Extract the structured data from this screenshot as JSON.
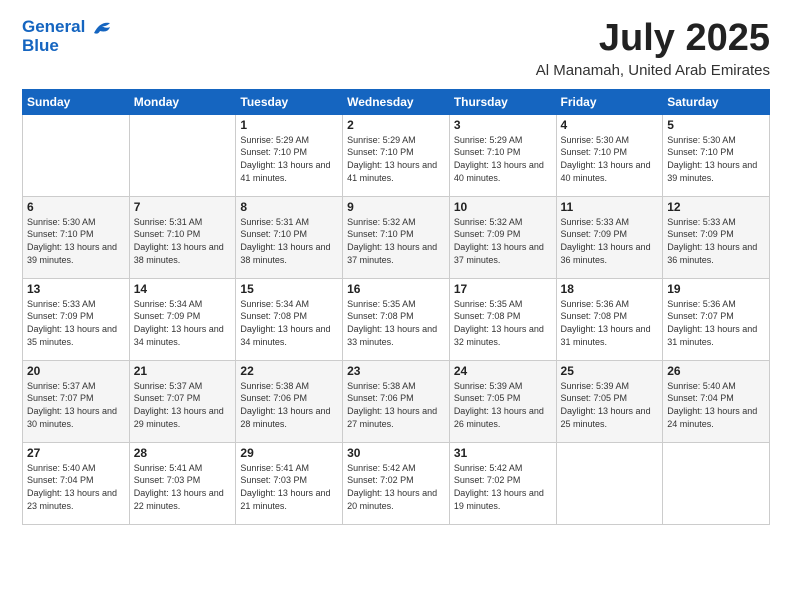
{
  "header": {
    "logo_line1": "General",
    "logo_line2": "Blue",
    "month": "July 2025",
    "location": "Al Manamah, United Arab Emirates"
  },
  "weekdays": [
    "Sunday",
    "Monday",
    "Tuesday",
    "Wednesday",
    "Thursday",
    "Friday",
    "Saturday"
  ],
  "weeks": [
    [
      {
        "day": "",
        "sunrise": "",
        "sunset": "",
        "daylight": ""
      },
      {
        "day": "",
        "sunrise": "",
        "sunset": "",
        "daylight": ""
      },
      {
        "day": "1",
        "sunrise": "Sunrise: 5:29 AM",
        "sunset": "Sunset: 7:10 PM",
        "daylight": "Daylight: 13 hours and 41 minutes."
      },
      {
        "day": "2",
        "sunrise": "Sunrise: 5:29 AM",
        "sunset": "Sunset: 7:10 PM",
        "daylight": "Daylight: 13 hours and 41 minutes."
      },
      {
        "day": "3",
        "sunrise": "Sunrise: 5:29 AM",
        "sunset": "Sunset: 7:10 PM",
        "daylight": "Daylight: 13 hours and 40 minutes."
      },
      {
        "day": "4",
        "sunrise": "Sunrise: 5:30 AM",
        "sunset": "Sunset: 7:10 PM",
        "daylight": "Daylight: 13 hours and 40 minutes."
      },
      {
        "day": "5",
        "sunrise": "Sunrise: 5:30 AM",
        "sunset": "Sunset: 7:10 PM",
        "daylight": "Daylight: 13 hours and 39 minutes."
      }
    ],
    [
      {
        "day": "6",
        "sunrise": "Sunrise: 5:30 AM",
        "sunset": "Sunset: 7:10 PM",
        "daylight": "Daylight: 13 hours and 39 minutes."
      },
      {
        "day": "7",
        "sunrise": "Sunrise: 5:31 AM",
        "sunset": "Sunset: 7:10 PM",
        "daylight": "Daylight: 13 hours and 38 minutes."
      },
      {
        "day": "8",
        "sunrise": "Sunrise: 5:31 AM",
        "sunset": "Sunset: 7:10 PM",
        "daylight": "Daylight: 13 hours and 38 minutes."
      },
      {
        "day": "9",
        "sunrise": "Sunrise: 5:32 AM",
        "sunset": "Sunset: 7:10 PM",
        "daylight": "Daylight: 13 hours and 37 minutes."
      },
      {
        "day": "10",
        "sunrise": "Sunrise: 5:32 AM",
        "sunset": "Sunset: 7:09 PM",
        "daylight": "Daylight: 13 hours and 37 minutes."
      },
      {
        "day": "11",
        "sunrise": "Sunrise: 5:33 AM",
        "sunset": "Sunset: 7:09 PM",
        "daylight": "Daylight: 13 hours and 36 minutes."
      },
      {
        "day": "12",
        "sunrise": "Sunrise: 5:33 AM",
        "sunset": "Sunset: 7:09 PM",
        "daylight": "Daylight: 13 hours and 36 minutes."
      }
    ],
    [
      {
        "day": "13",
        "sunrise": "Sunrise: 5:33 AM",
        "sunset": "Sunset: 7:09 PM",
        "daylight": "Daylight: 13 hours and 35 minutes."
      },
      {
        "day": "14",
        "sunrise": "Sunrise: 5:34 AM",
        "sunset": "Sunset: 7:09 PM",
        "daylight": "Daylight: 13 hours and 34 minutes."
      },
      {
        "day": "15",
        "sunrise": "Sunrise: 5:34 AM",
        "sunset": "Sunset: 7:08 PM",
        "daylight": "Daylight: 13 hours and 34 minutes."
      },
      {
        "day": "16",
        "sunrise": "Sunrise: 5:35 AM",
        "sunset": "Sunset: 7:08 PM",
        "daylight": "Daylight: 13 hours and 33 minutes."
      },
      {
        "day": "17",
        "sunrise": "Sunrise: 5:35 AM",
        "sunset": "Sunset: 7:08 PM",
        "daylight": "Daylight: 13 hours and 32 minutes."
      },
      {
        "day": "18",
        "sunrise": "Sunrise: 5:36 AM",
        "sunset": "Sunset: 7:08 PM",
        "daylight": "Daylight: 13 hours and 31 minutes."
      },
      {
        "day": "19",
        "sunrise": "Sunrise: 5:36 AM",
        "sunset": "Sunset: 7:07 PM",
        "daylight": "Daylight: 13 hours and 31 minutes."
      }
    ],
    [
      {
        "day": "20",
        "sunrise": "Sunrise: 5:37 AM",
        "sunset": "Sunset: 7:07 PM",
        "daylight": "Daylight: 13 hours and 30 minutes."
      },
      {
        "day": "21",
        "sunrise": "Sunrise: 5:37 AM",
        "sunset": "Sunset: 7:07 PM",
        "daylight": "Daylight: 13 hours and 29 minutes."
      },
      {
        "day": "22",
        "sunrise": "Sunrise: 5:38 AM",
        "sunset": "Sunset: 7:06 PM",
        "daylight": "Daylight: 13 hours and 28 minutes."
      },
      {
        "day": "23",
        "sunrise": "Sunrise: 5:38 AM",
        "sunset": "Sunset: 7:06 PM",
        "daylight": "Daylight: 13 hours and 27 minutes."
      },
      {
        "day": "24",
        "sunrise": "Sunrise: 5:39 AM",
        "sunset": "Sunset: 7:05 PM",
        "daylight": "Daylight: 13 hours and 26 minutes."
      },
      {
        "day": "25",
        "sunrise": "Sunrise: 5:39 AM",
        "sunset": "Sunset: 7:05 PM",
        "daylight": "Daylight: 13 hours and 25 minutes."
      },
      {
        "day": "26",
        "sunrise": "Sunrise: 5:40 AM",
        "sunset": "Sunset: 7:04 PM",
        "daylight": "Daylight: 13 hours and 24 minutes."
      }
    ],
    [
      {
        "day": "27",
        "sunrise": "Sunrise: 5:40 AM",
        "sunset": "Sunset: 7:04 PM",
        "daylight": "Daylight: 13 hours and 23 minutes."
      },
      {
        "day": "28",
        "sunrise": "Sunrise: 5:41 AM",
        "sunset": "Sunset: 7:03 PM",
        "daylight": "Daylight: 13 hours and 22 minutes."
      },
      {
        "day": "29",
        "sunrise": "Sunrise: 5:41 AM",
        "sunset": "Sunset: 7:03 PM",
        "daylight": "Daylight: 13 hours and 21 minutes."
      },
      {
        "day": "30",
        "sunrise": "Sunrise: 5:42 AM",
        "sunset": "Sunset: 7:02 PM",
        "daylight": "Daylight: 13 hours and 20 minutes."
      },
      {
        "day": "31",
        "sunrise": "Sunrise: 5:42 AM",
        "sunset": "Sunset: 7:02 PM",
        "daylight": "Daylight: 13 hours and 19 minutes."
      },
      {
        "day": "",
        "sunrise": "",
        "sunset": "",
        "daylight": ""
      },
      {
        "day": "",
        "sunrise": "",
        "sunset": "",
        "daylight": ""
      }
    ]
  ]
}
